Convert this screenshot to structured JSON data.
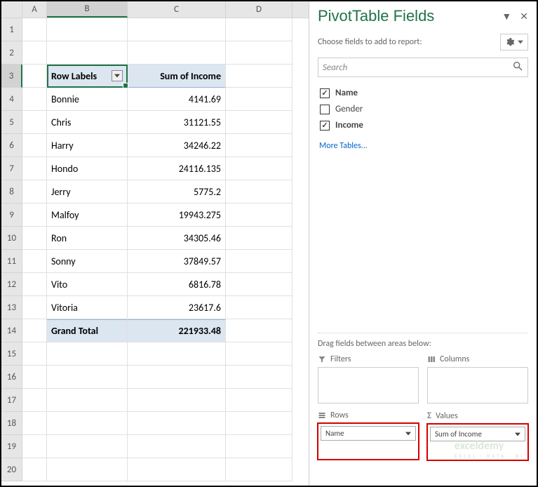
{
  "columns": [
    "A",
    "B",
    "C",
    "D"
  ],
  "rowNumbers": [
    1,
    2,
    3,
    4,
    5,
    6,
    7,
    8,
    9,
    10,
    11,
    12,
    13,
    14,
    15,
    16,
    17,
    18,
    19,
    20
  ],
  "headers": {
    "rowLabels": "Row Labels",
    "sumIncome": "Sum of Income"
  },
  "pivotData": [
    {
      "label": "Bonnie",
      "value": "4141.69"
    },
    {
      "label": "Chris",
      "value": "31121.55"
    },
    {
      "label": "Harry",
      "value": "34246.22"
    },
    {
      "label": "Hondo",
      "value": "24116.135"
    },
    {
      "label": "Jerry",
      "value": "5775.2"
    },
    {
      "label": "Malfoy",
      "value": "19943.275"
    },
    {
      "label": "Ron",
      "value": "34305.46"
    },
    {
      "label": "Sonny",
      "value": "37849.57"
    },
    {
      "label": "Vito",
      "value": "6816.78"
    },
    {
      "label": "Vitoria",
      "value": "23617.6"
    }
  ],
  "grandTotal": {
    "label": "Grand Total",
    "value": "221933.48"
  },
  "pane": {
    "title": "PivotTable Fields",
    "chooseLabel": "Choose fields to add to report:",
    "searchPlaceholder": "Search",
    "fields": [
      {
        "name": "Name",
        "checked": true
      },
      {
        "name": "Gender",
        "checked": false
      },
      {
        "name": "Income",
        "checked": true
      }
    ],
    "moreTables": "More Tables...",
    "dragLabel": "Drag fields between areas below:",
    "areas": {
      "filters": {
        "title": "Filters",
        "items": []
      },
      "columns": {
        "title": "Columns",
        "items": []
      },
      "rows": {
        "title": "Rows",
        "items": [
          "Name"
        ],
        "highlight": true
      },
      "values": {
        "title": "Values",
        "items": [
          "Sum of Income"
        ],
        "highlight": true
      }
    }
  },
  "watermark": {
    "main": "exceldemy",
    "sub": "EXCEL · DATA · BI"
  }
}
